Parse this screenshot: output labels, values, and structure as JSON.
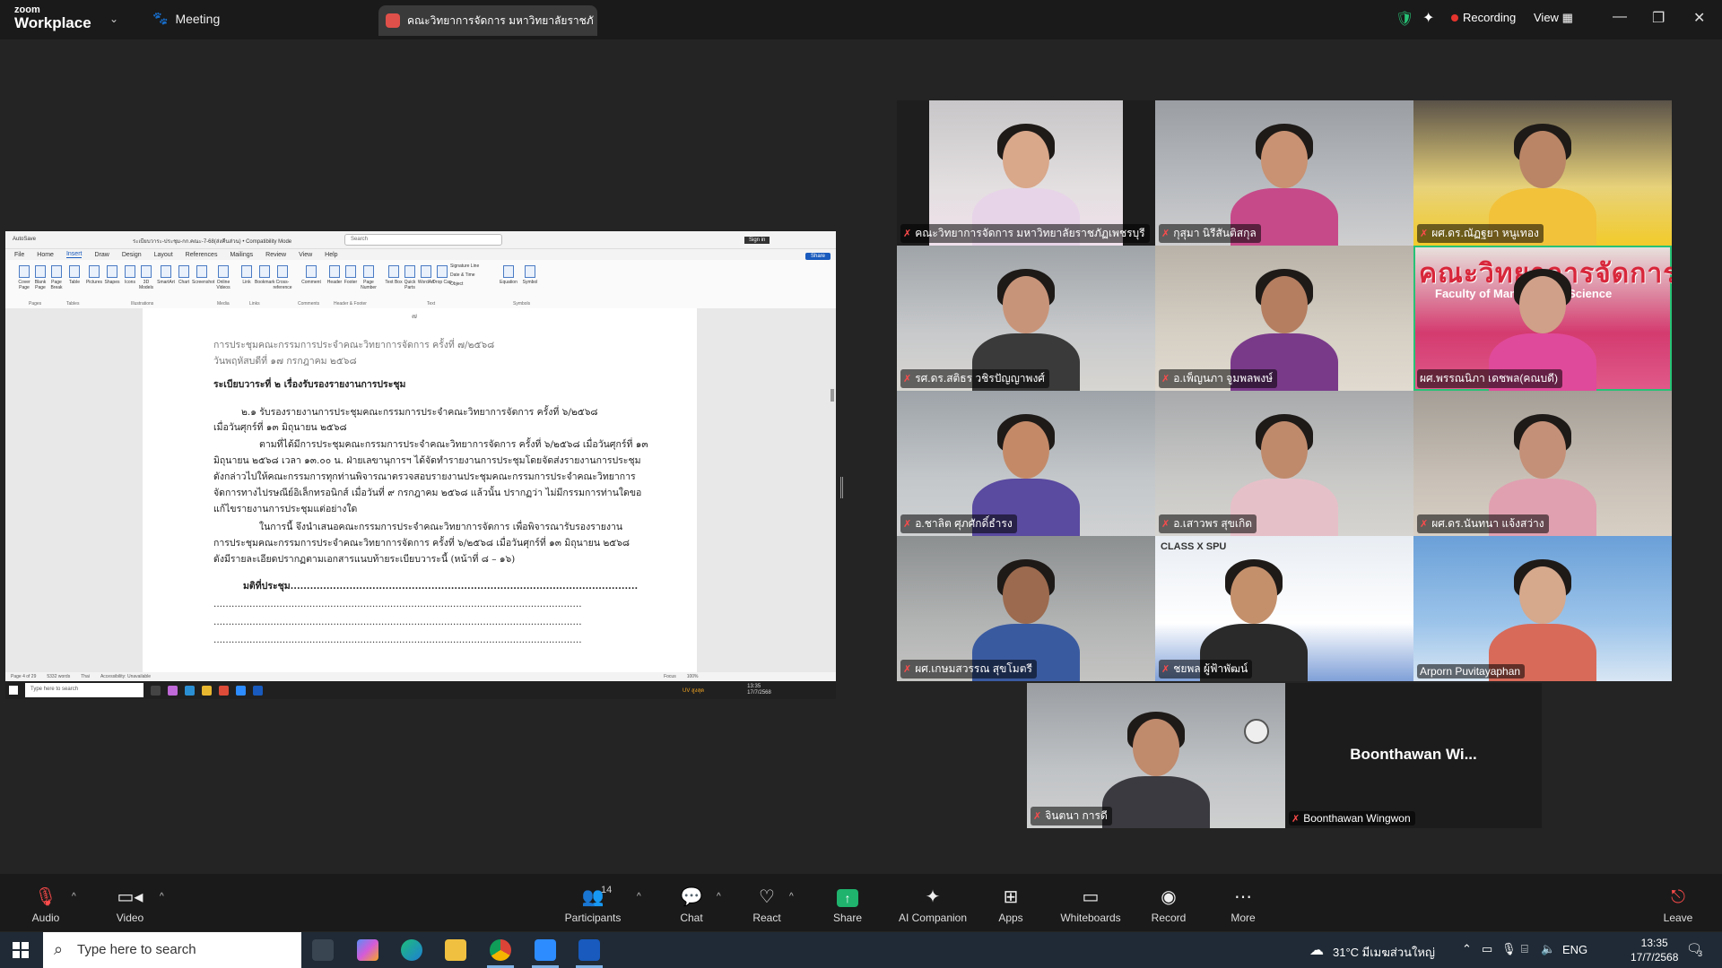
{
  "titlebar": {
    "logo_line1": "zoom",
    "logo_line2": "Workplace",
    "meeting_label": "Meeting",
    "share_tab_title": "คณะวิทยาการจัดการ มหาวิทยาลัยราชภั",
    "recording_label": "Recording",
    "view_label": "View"
  },
  "word": {
    "autosave": "AutoSave",
    "doc_title": "ระเบียบวาระ-ประชุม-กก.คณะ-7-68(ส่งคืนส่วน) • Compatibility Mode",
    "search_placeholder": "Search",
    "signin": "Sign in",
    "share": "Share",
    "tabs": [
      "File",
      "Home",
      "Insert",
      "Draw",
      "Design",
      "Layout",
      "References",
      "Mailings",
      "Review",
      "View",
      "Help"
    ],
    "active_tab": "Insert",
    "ribbon_items": [
      "Cover Page",
      "Blank Page",
      "Page Break",
      "Table",
      "Pictures",
      "Shapes",
      "Icons",
      "3D Models",
      "SmartArt",
      "Chart",
      "Screenshot",
      "Online Videos",
      "Link",
      "Bookmark",
      "Cross-reference",
      "Comment",
      "Header",
      "Footer",
      "Page Number",
      "Text Box",
      "Quick Parts",
      "WordArt",
      "Drop Cap",
      "Signature Line",
      "Date & Time",
      "Object",
      "Equation",
      "Symbol"
    ],
    "ribbon_groups": [
      "Pages",
      "Tables",
      "Illustrations",
      "Media",
      "Links",
      "Comments",
      "Header & Footer",
      "Text",
      "Symbols"
    ],
    "page_number_mark": "๗",
    "header_line1": "การประชุมคณะกรรมการประจำคณะวิทยาการจัดการ ครั้งที่ ๗/๒๕๖๘",
    "header_line2": "วันพฤหัสบดีที่ ๑๗ กรกฎาคม ๒๕๖๘",
    "agenda_heading": "ระเบียบวาระที่ ๒ เรื่องรับรองรายงานการประชุม",
    "para1_l1": "๒.๑ รับรองรายงานการประชุมคณะกรรมการประจำคณะวิทยาการจัดการ ครั้งที่ ๖/๒๕๖๘",
    "para1_l2": "เมื่อวันศุกร์ที่ ๑๓ มิถุนายน ๒๕๖๘",
    "para2_l1": "ตามที่ได้มีการประชุมคณะกรรมการประจำคณะวิทยาการจัดการ ครั้งที่ ๖/๒๕๖๘ เมื่อวันศุกร์ที่ ๑๓",
    "para2_l2": "มิถุนายน ๒๕๖๘ เวลา ๑๓.๐๐ น. ฝ่ายเลขานุการฯ ได้จัดทำรายงานการประชุมโดยจัดส่งรายงานการประชุม",
    "para2_l3": "ดังกล่าวไปให้คณะกรรมการทุกท่านพิจารณาตรวจสอบรายงานประชุมคณะกรรมการประจำคณะวิทยาการ",
    "para2_l4": "จัดการทางไปรษณีย์อิเล็กทรอนิกส์ เมื่อวันที่ ๙ กรกฎาคม ๒๕๖๘ แล้วนั้น ปรากฏว่า ไม่มีกรรมการท่านใดขอ",
    "para2_l5": "แก้ไขรายงานการประชุมแต่อย่างใด",
    "para3_l1": "ในการนี้ จึงนำเสนอคณะกรรมการประจำคณะวิทยาการจัดการ เพื่อพิจารณารับรองรายงาน",
    "para3_l2": "การประชุมคณะกรรมการประจำคณะวิทยาการจัดการ ครั้งที่ ๖/๒๕๖๘ เมื่อวันศุกร์ที่ ๑๓ มิถุนายน ๒๕๖๘",
    "para3_l3": "ดังมีรายละเอียดปรากฏตามเอกสารแนบท้ายระเบียบวาระนี้ (หน้าที่ ๘ – ๑๖)",
    "resolution": "มติที่ประชุม..........................................................................................................",
    "dots": "...........................................................................................................................",
    "status_page": "Page 4 of 29",
    "status_words": "5332 words",
    "status_lang": "Thai",
    "status_access": "Accessibility: Unavailable",
    "status_focus": "Focus",
    "status_zoom": "100%",
    "inner_search": "Type here to search",
    "inner_weather": "UV สูงสุด",
    "inner_time": "13:35",
    "inner_date": "17/7/2568"
  },
  "participants": [
    {
      "name": "คณะวิทยาการจัดการ มหาวิทยาลัยราชภัฏเพชรบุรี",
      "muted": true
    },
    {
      "name": "กุสุมา นิรีสันติสกุล",
      "muted": true
    },
    {
      "name": "ผศ.ดร.ณัฏฐยา หนูเทอง",
      "muted": true
    },
    {
      "name": "รศ.ดร.สติธร วชิรปัญญาพงศ์",
      "muted": true
    },
    {
      "name": "อ.เพ็ญนภา จูมพลพงษ์",
      "muted": true
    },
    {
      "name": "ผศ.พรรณนิภา เดชพล(คณบดี)",
      "muted": false
    },
    {
      "name": "อ.ชาลิต ศุภศักดิ์ธำรง",
      "muted": true
    },
    {
      "name": "อ.เสาวพร สุขเกิด",
      "muted": true
    },
    {
      "name": "ผศ.ดร.นันทนา แจ้งสว่าง",
      "muted": true
    },
    {
      "name": "ผศ.เกษมสวรรณ สุขโมตรี",
      "muted": true
    },
    {
      "name": "ชยพล ผู้ฟ้าพัฒน์",
      "muted": true
    },
    {
      "name": "Arporn Puvitayaphan",
      "muted": false
    },
    {
      "name": "จินตนา การดี",
      "muted": true
    },
    {
      "name": "Boonthawan Wingwon",
      "muted": true
    }
  ],
  "big_name_display": "Boonthawan  Wi...",
  "tile_texts": {
    "banner_line1": "คณะวิทยาการจัดการ",
    "banner_line2": "Faculty of Management Science",
    "classx": "CLASS X SPU"
  },
  "toolbar": {
    "audio": "Audio",
    "video": "Video",
    "participants": "Participants",
    "participant_count": "14",
    "chat": "Chat",
    "react": "React",
    "share": "Share",
    "ai": "AI Companion",
    "apps": "Apps",
    "whiteboards": "Whiteboards",
    "record": "Record",
    "more": "More",
    "leave": "Leave"
  },
  "taskbar": {
    "search_placeholder": "Type here to search",
    "weather": "31°C  มีเมฆส่วนใหญ่",
    "lang": "ENG",
    "time": "13:35",
    "date": "17/7/2568",
    "notif_count": "3"
  },
  "colors": {
    "accent_green": "#27c276",
    "rec_red": "#e5342d",
    "word_blue": "#185abd"
  }
}
